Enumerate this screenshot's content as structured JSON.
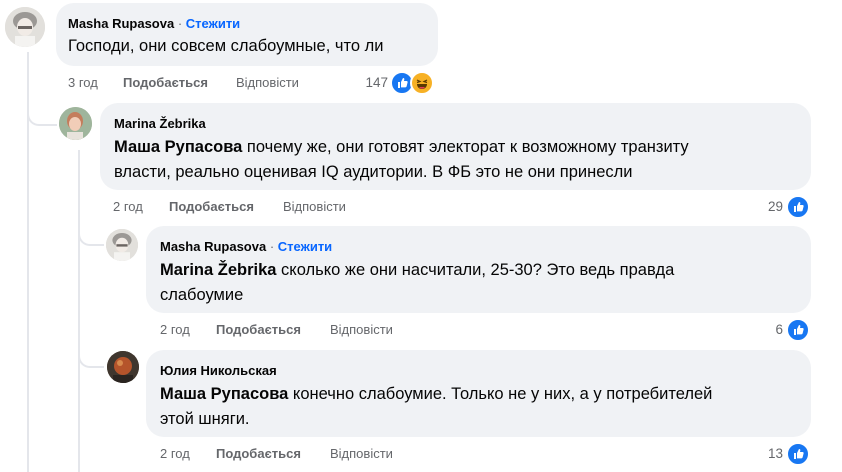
{
  "comments": [
    {
      "author": "Masha Rupasova",
      "dot": "·",
      "follow": "Стежити",
      "text": "Господи, они совсем слабоумные, что ли",
      "time": "3 год",
      "like": "Подобається",
      "reply": "Відповісти",
      "reactions_count": "147"
    },
    {
      "author": "Marina Žebrika",
      "mention": "Маша Рупасова",
      "text_line1": " почему же, они готовят электорат к возможному транзиту",
      "text_line2": "власти, реально оценивая IQ аудитории. В ФБ это не они принесли",
      "time": "2 год",
      "like": "Подобається",
      "reply": "Відповісти",
      "reactions_count": "29"
    },
    {
      "author": "Masha Rupasova",
      "dot": "·",
      "follow": "Стежити",
      "mention": "Marina Žebrika",
      "text_line1": " сколько же они насчитали, 25-30? Это ведь правда",
      "text_line2": "слабоумие",
      "time": "2 год",
      "like": "Подобається",
      "reply": "Відповісти",
      "reactions_count": "6"
    },
    {
      "author": "Юлия Никольская",
      "mention": "Маша Рупасова",
      "text_line1": " конечно слабоумие. Только не у них, а у потребителей",
      "text_line2": "этой шняги.",
      "time": "2 год",
      "like": "Подобається",
      "reply": "Відповісти",
      "reactions_count": "13"
    }
  ],
  "colors": {
    "bubble": "#f0f2f5",
    "link": "#0866ff",
    "muted": "#65676b",
    "like": "#1877f2",
    "haha": "#f7b125"
  },
  "icons": [
    "like-reaction-icon",
    "haha-reaction-icon"
  ]
}
